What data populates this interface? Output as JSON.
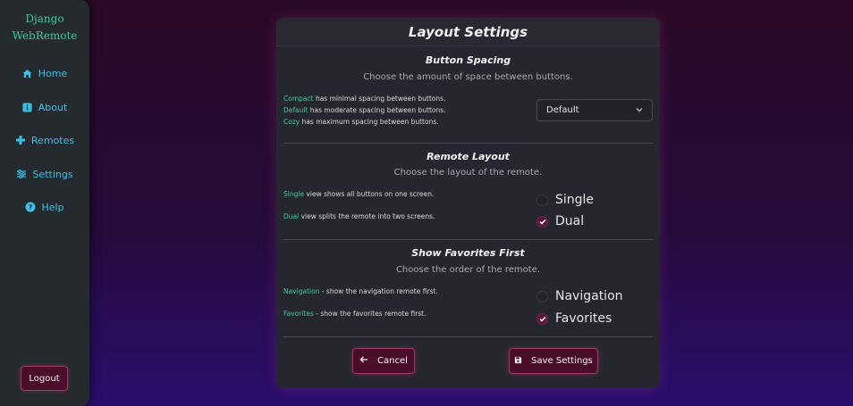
{
  "sidebar": {
    "brand_line1": "Django",
    "brand_line2": "WebRemote",
    "items": [
      {
        "label": "Home",
        "icon": "home-icon"
      },
      {
        "label": "About",
        "icon": "info-icon"
      },
      {
        "label": "Remotes",
        "icon": "gamepad-icon"
      },
      {
        "label": "Settings",
        "icon": "sliders-icon"
      },
      {
        "label": "Help",
        "icon": "question-icon"
      }
    ],
    "logout_label": "Logout"
  },
  "card": {
    "title": "Layout Settings",
    "spacing": {
      "title": "Button Spacing",
      "description": "Choose the amount of space between buttons.",
      "help": [
        {
          "key": "Compact",
          "text": " has minimal spacing between buttons."
        },
        {
          "key": "Default",
          "text": " has moderate spacing between buttons."
        },
        {
          "key": "Cozy",
          "text": " has maximum spacing between buttons."
        }
      ],
      "selected": "Default"
    },
    "layout": {
      "title": "Remote Layout",
      "description": "Choose the layout of the remote.",
      "help": [
        {
          "key": "Single",
          "text": " view shows all buttons on one screen."
        },
        {
          "key": "Dual",
          "text": " view splits the remote into two screens."
        }
      ],
      "options": [
        {
          "label": "Single",
          "checked": false
        },
        {
          "label": "Dual",
          "checked": true
        }
      ]
    },
    "favorites": {
      "title": "Show Favorites First",
      "description": "Choose the order of the remote.",
      "help": [
        {
          "key": "Navigation",
          "text": " - show the navigation remote first."
        },
        {
          "key": "Favorites",
          "text": " - show the favorites remote first."
        }
      ],
      "options": [
        {
          "label": "Navigation",
          "checked": false
        },
        {
          "label": "Favorites",
          "checked": true
        }
      ]
    },
    "cancel_label": "Cancel",
    "save_label": "Save Settings"
  },
  "colors": {
    "accent": "#3ec9a0",
    "nav_link": "#3bc1e8",
    "button_bg": "#4b0d2c",
    "card_bg": "#262630"
  }
}
